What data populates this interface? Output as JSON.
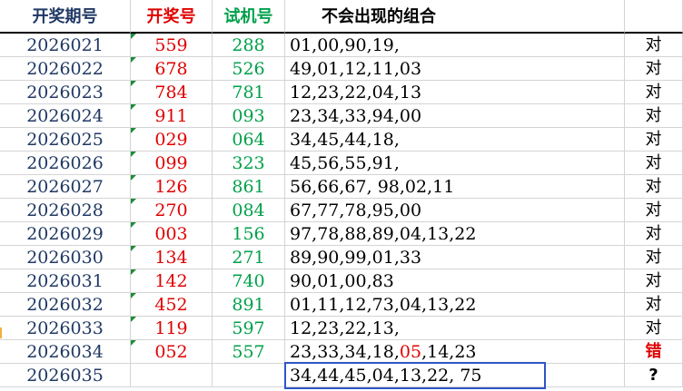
{
  "header": {
    "issue": "开奖期号",
    "draw": "开奖号",
    "test": "试机号",
    "combo": "不会出现的组合"
  },
  "rows": [
    {
      "issue": "2026021",
      "draw": "559",
      "test": "288",
      "combo": "01,00,90,19,",
      "result": "对"
    },
    {
      "issue": "2026022",
      "draw": "678",
      "test": "526",
      "combo": "49,01,12,11,03",
      "result": "对"
    },
    {
      "issue": "2026023",
      "draw": "784",
      "test": "781",
      "combo": "12,23,22,04,13",
      "result": "对"
    },
    {
      "issue": "2026024",
      "draw": "911",
      "test": "093",
      "combo": "23,34,33,94,00",
      "result": "对"
    },
    {
      "issue": "2026025",
      "draw": "029",
      "test": "064",
      "combo": "34,45,44,18,",
      "result": "对"
    },
    {
      "issue": "2026026",
      "draw": "099",
      "test": "323",
      "combo": "45,56,55,91,",
      "result": "对"
    },
    {
      "issue": "2026027",
      "draw": "126",
      "test": "861",
      "combo": "56,66,67, 98,02,11",
      "result": "对"
    },
    {
      "issue": "2026028",
      "draw": "270",
      "test": "084",
      "combo": "67,77,78,95,00",
      "result": "对"
    },
    {
      "issue": "2026029",
      "draw": "003",
      "test": "156",
      "combo": "97,78,88,89,04,13,22",
      "result": "对"
    },
    {
      "issue": "2026030",
      "draw": "134",
      "test": "271",
      "combo": "89,90,99,01,33",
      "result": "对"
    },
    {
      "issue": "2026031",
      "draw": "142",
      "test": "740",
      "combo": "90,01,00,83",
      "result": "对"
    },
    {
      "issue": "2026032",
      "draw": "452",
      "test": "891",
      "combo": "01,11,12,73,04,13,22",
      "result": "对"
    },
    {
      "issue": "2026033",
      "draw": "119",
      "test": "597",
      "combo": "12,23,22,13,",
      "result": "对"
    }
  ],
  "row34": {
    "issue": "2026034",
    "draw": "052",
    "test": "557",
    "combo_a": "23,33,34,18,",
    "combo_hit": "05",
    "combo_b": ",14,23",
    "result": "错"
  },
  "row35": {
    "issue": "2026035",
    "draw": "",
    "test": "",
    "combo": "34,44,45,04,13,22, 75",
    "result": "?"
  },
  "colors": {
    "issue": "#1f3864",
    "draw": "#e00000",
    "test": "#00a04a",
    "box": "#2f55c8",
    "grid": "#d4d4d4"
  }
}
